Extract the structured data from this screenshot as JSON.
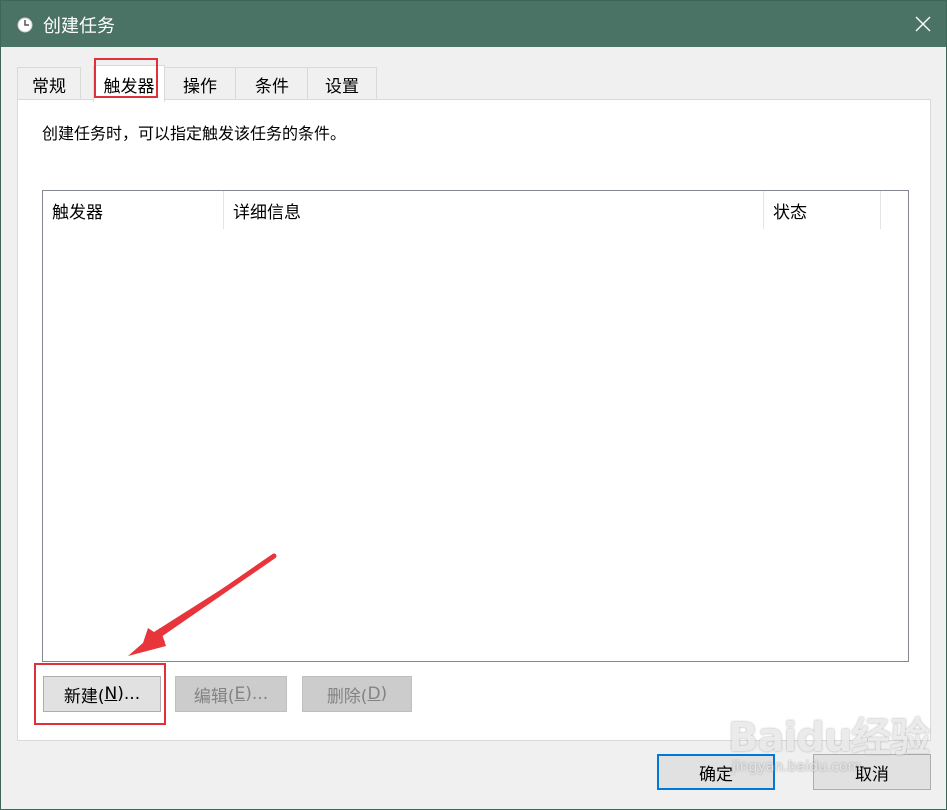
{
  "window": {
    "title": "创建任务",
    "close_glyph": "✕"
  },
  "tabs": [
    {
      "label": "常规"
    },
    {
      "label": "触发器"
    },
    {
      "label": "操作"
    },
    {
      "label": "条件"
    },
    {
      "label": "设置"
    }
  ],
  "active_tab": "触发器",
  "panel": {
    "description": "创建任务时，可以指定触发该任务的条件。",
    "columns": [
      "触发器",
      "详细信息",
      "状态"
    ],
    "rows": []
  },
  "buttons": {
    "new_pre": "新建(",
    "new_key": "N",
    "new_post": ")...",
    "edit_pre": "编辑(",
    "edit_key": "E",
    "edit_post": ")...",
    "delete_pre": "删除(",
    "delete_key": "D",
    "delete_post": ")",
    "ok": "确定",
    "cancel": "取消"
  },
  "watermark": {
    "logo": "Baidu经验",
    "url": "jingyan.baidu.com"
  },
  "colors": {
    "titlebar": "#4a7265",
    "highlight": "#e0303a",
    "focus": "#0078d7"
  }
}
